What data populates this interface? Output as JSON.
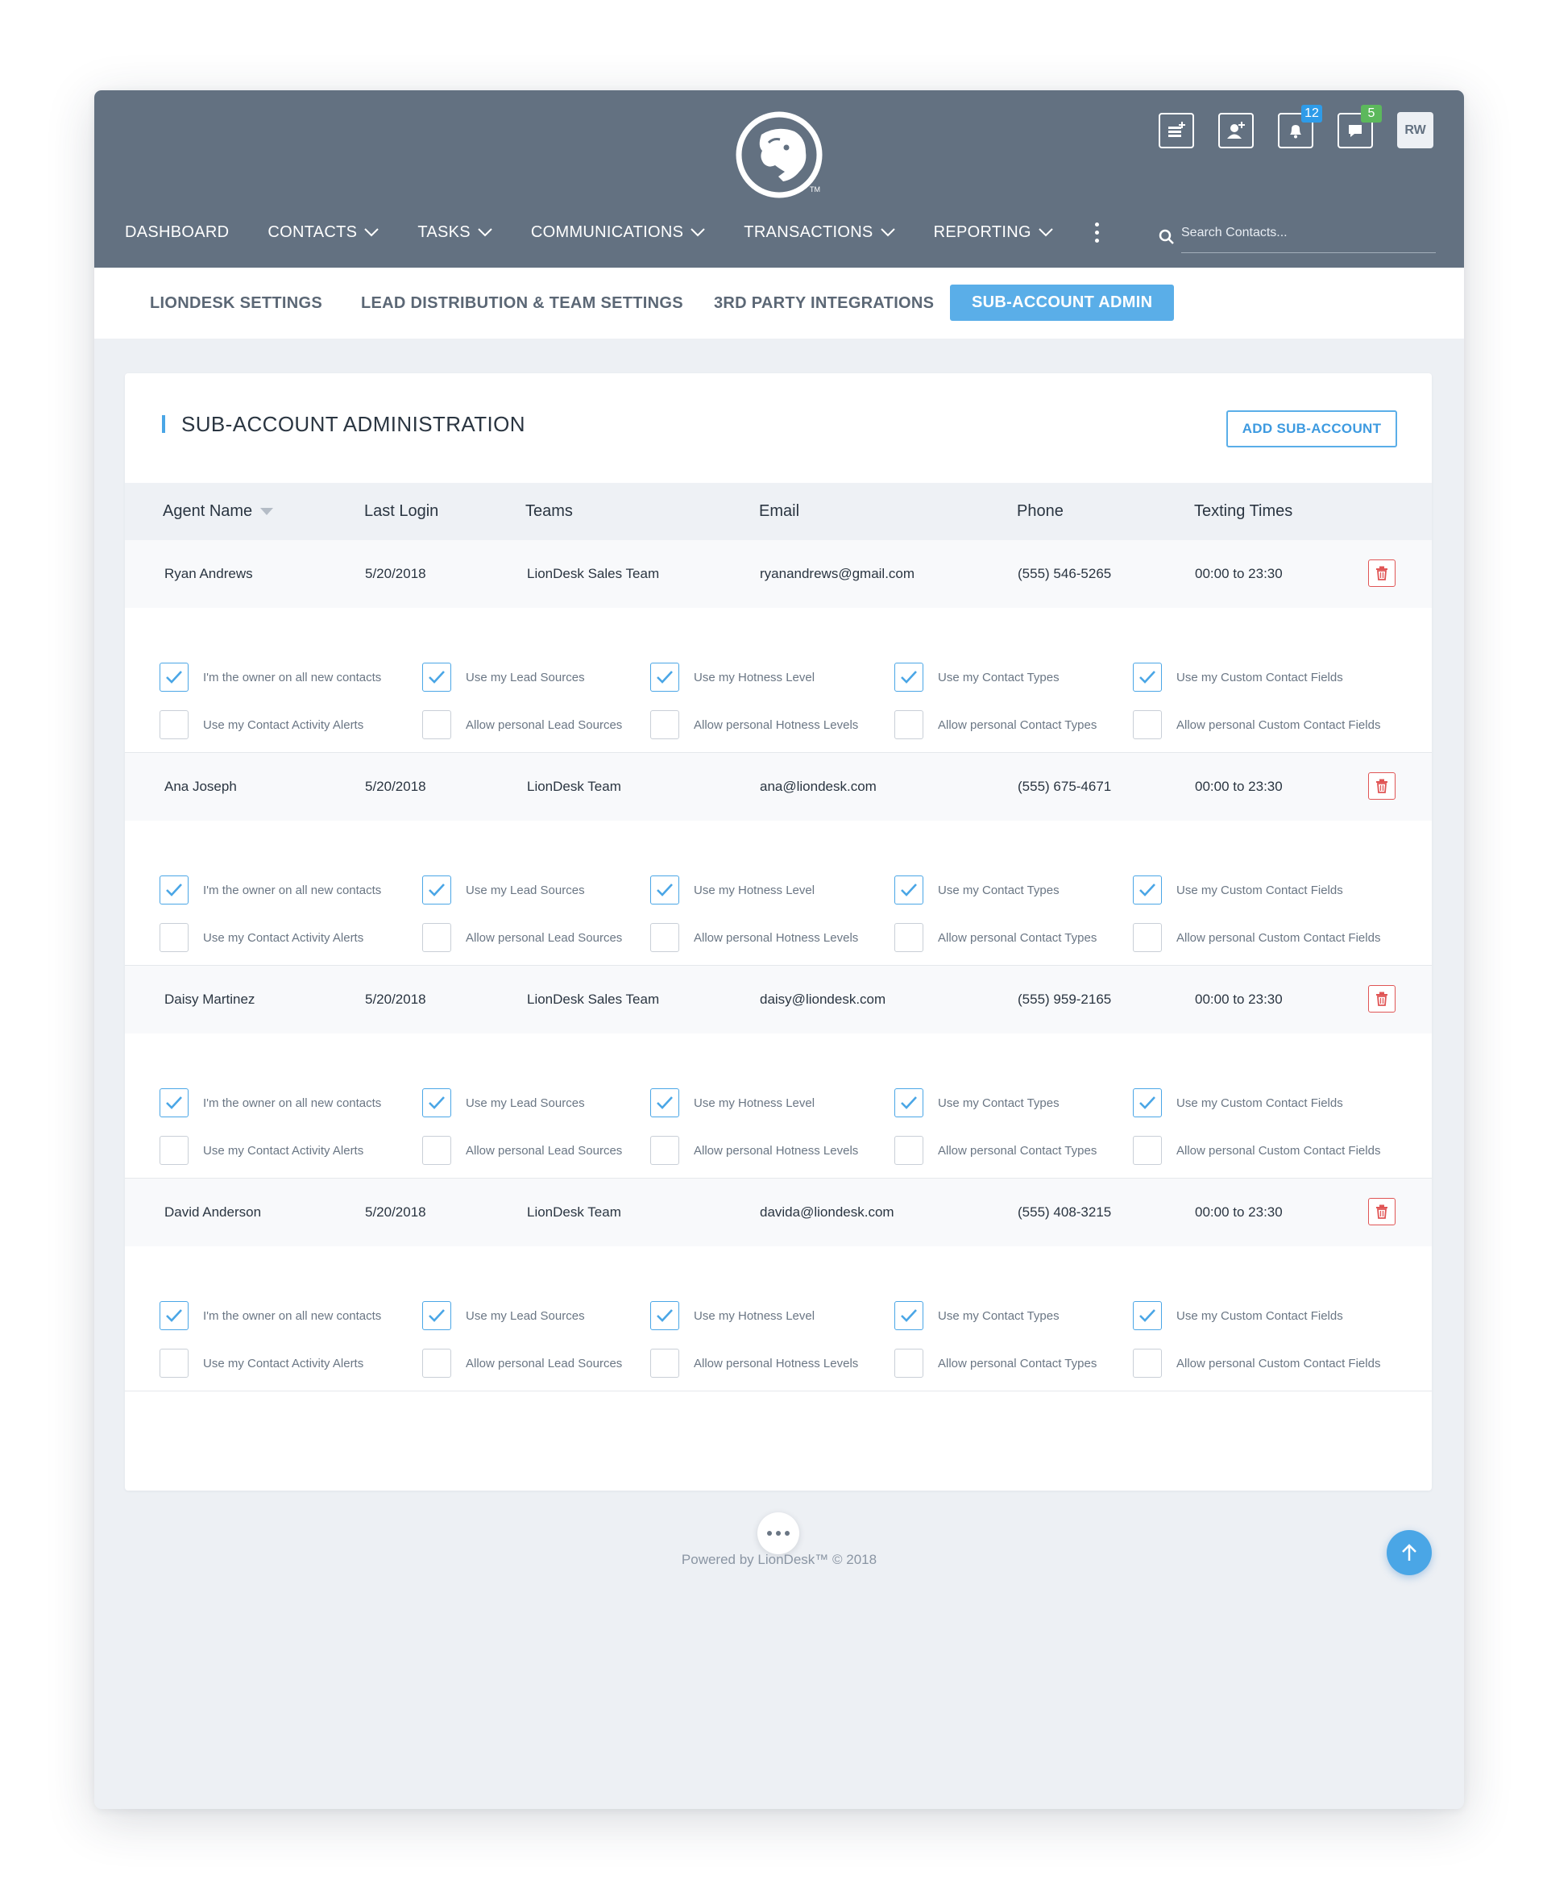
{
  "header": {
    "tm": "TM",
    "avatar_initials": "RW",
    "notifications_count": "12",
    "messages_count": "5",
    "search_placeholder": "Search Contacts..."
  },
  "nav": {
    "dashboard": "DASHBOARD",
    "contacts": "CONTACTS",
    "tasks": "TASKS",
    "communications": "COMMUNICATIONS",
    "transactions": "TRANSACTIONS",
    "reporting": "REPORTING"
  },
  "subnav": {
    "liondesk_settings": "LIONDESK SETTINGS",
    "lead_distribution": "LEAD DISTRIBUTION & TEAM SETTINGS",
    "third_party": "3RD PARTY INTEGRATIONS",
    "sub_account_admin": "SUB-ACCOUNT ADMIN"
  },
  "card": {
    "title": "SUB-ACCOUNT ADMINISTRATION",
    "add_button": "ADD SUB-ACCOUNT"
  },
  "columns": {
    "agent_name": "Agent Name",
    "last_login": "Last Login",
    "teams": "Teams",
    "email": "Email",
    "phone": "Phone",
    "texting_times": "Texting Times"
  },
  "option_labels": {
    "owner_new_contacts": "I'm the owner on all new contacts",
    "use_lead_sources": "Use my Lead Sources",
    "use_hotness_level": "Use my Hotness Level",
    "use_contact_types": "Use my Contact Types",
    "use_custom_fields": "Use my Custom Contact Fields",
    "use_activity_alerts": "Use my Contact Activity Alerts",
    "allow_lead_sources": "Allow personal Lead Sources",
    "allow_hotness_levels": "Allow personal Hotness Levels",
    "allow_contact_types": "Allow personal Contact Types",
    "allow_custom_fields": "Allow personal Custom Contact Fields"
  },
  "agents": [
    {
      "name": "Ryan Andrews",
      "last_login": "5/20/2018",
      "team": "LionDesk Sales Team",
      "email": "ryanandrews@gmail.com",
      "phone": "(555) 546-5265",
      "texting_times": "00:00 to 23:30",
      "options": [
        true,
        true,
        true,
        true,
        true,
        false,
        false,
        false,
        false,
        false
      ]
    },
    {
      "name": "Ana Joseph",
      "last_login": "5/20/2018",
      "team": "LionDesk Team",
      "email": "ana@liondesk.com",
      "phone": "(555) 675-4671",
      "texting_times": "00:00 to 23:30",
      "options": [
        true,
        true,
        true,
        true,
        true,
        false,
        false,
        false,
        false,
        false
      ]
    },
    {
      "name": "Daisy Martinez",
      "last_login": "5/20/2018",
      "team": "LionDesk Sales Team",
      "email": "daisy@liondesk.com",
      "phone": "(555) 959-2165",
      "texting_times": "00:00 to 23:30",
      "options": [
        true,
        true,
        true,
        true,
        true,
        false,
        false,
        false,
        false,
        false
      ]
    },
    {
      "name": "David Anderson",
      "last_login": "5/20/2018",
      "team": "LionDesk Team",
      "email": "davida@liondesk.com",
      "phone": "(555) 408-3215",
      "texting_times": "00:00 to 23:30",
      "options": [
        true,
        true,
        true,
        true,
        true,
        false,
        false,
        false,
        false,
        false
      ]
    }
  ],
  "footer": {
    "text": "Powered by LionDesk™ © 2018"
  },
  "colors": {
    "topbar": "#637181",
    "accent": "#5aaee8",
    "danger": "#e05555",
    "background": "#edf0f4"
  }
}
